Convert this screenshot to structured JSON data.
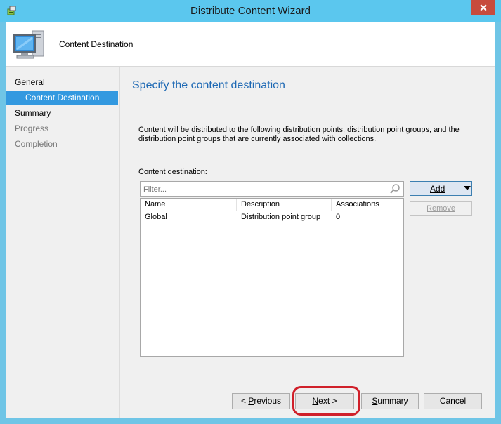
{
  "window": {
    "title": "Distribute Content Wizard",
    "close_glyph": "✕"
  },
  "header": {
    "title": "Content Destination",
    "icon": "computer-icon"
  },
  "nav": {
    "items": [
      {
        "label": "General",
        "state": "normal"
      },
      {
        "label": "Content Destination",
        "state": "selected"
      },
      {
        "label": "Summary",
        "state": "normal"
      },
      {
        "label": "Progress",
        "state": "disabled"
      },
      {
        "label": "Completion",
        "state": "disabled"
      }
    ]
  },
  "page": {
    "heading": "Specify the content destination",
    "description": "Content will be distributed to the following distribution points, distribution point groups, and the distribution point groups that are currently associated with collections.",
    "dest_label_pre": "Content ",
    "dest_label_u": "d",
    "dest_label_post": "estination:"
  },
  "filter": {
    "placeholder": "Filter...",
    "value": ""
  },
  "table": {
    "columns": [
      "Name",
      "Description",
      "Associations"
    ],
    "rows": [
      [
        "Global",
        "Distribution point group",
        "0"
      ]
    ]
  },
  "side_buttons": {
    "add": "Add",
    "remove": "Remove"
  },
  "footer": {
    "previous_pre": "< ",
    "previous_u": "P",
    "previous_post": "revious",
    "next_u": "N",
    "next_post": "ext >",
    "summary_u": "S",
    "summary_post": "ummary",
    "cancel": "Cancel"
  },
  "colors": {
    "titlebar": "#5bc7ee",
    "close": "#c74b3c",
    "selection": "#3399e0",
    "heading": "#1e69b4",
    "highlight": "#d0202a"
  }
}
